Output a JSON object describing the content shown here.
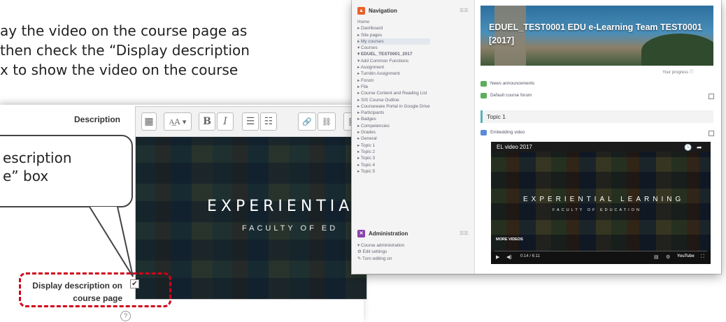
{
  "instructions": {
    "line1": "ay the video on the course page as",
    "line2": "then check the “Display description",
    "line3": "x to show the video on the course"
  },
  "callout": {
    "line1": "escription",
    "line2": "e” box"
  },
  "settings": {
    "description_label": "Description",
    "display_description_line1": "Display description on",
    "display_description_line2": "course page",
    "display_description_checked": true,
    "checkbox_glyph": "✔",
    "help_glyph": "?",
    "editor_text_line1": "EXPERIENTIAL",
    "editor_text_line2": "FACULTY OF ED",
    "toolbar": [
      "▦",
      "A͟A ▾",
      "B",
      "I",
      "☰",
      "☷",
      "🔗",
      "⛓",
      "▣"
    ]
  },
  "moodle": {
    "nav_title": "Navigation",
    "nav_control": "☰☰",
    "nav_items": [
      "Home",
      "▸ Dashboard",
      "▸ Site pages",
      "▸ My courses",
      "▾ Courses",
      "  ▾ EDUEL_TEST0001_2017",
      "    ▾ Add Common Functions",
      "      ▸ Assignment",
      "      ▸ Turnitin Assignment",
      "      ▸ Forum",
      "      ▸ File",
      "  ▸ Course Content and Reading List",
      "  ▸ SIS Course Outline",
      "  ▸ Courseware Portal in Google Drive",
      "  ▸ Participants",
      "  ▸ Badges",
      "  ▸ Competencies",
      "  ▸ Grades",
      "  ▸ General",
      "  ▸ Topic 1",
      "  ▸ Topic 2",
      "  ▸ Topic 3",
      "  ▸ Topic 4",
      "  ▸ Topic 5"
    ],
    "admin_title": "Administration",
    "admin_items": [
      "▾ Course administration",
      "⚙ Edit settings",
      "✎ Turn editing on"
    ],
    "course_title_line1": "EDUEL_TEST0001 EDU e-Learning Team TEST0001",
    "course_title_line2": "[2017]",
    "progress_label": "Your progress ⓘ",
    "activities": [
      "News announcements",
      "Default course forum"
    ],
    "topic_title": "Topic 1",
    "embed_label": "Embedding video",
    "video": {
      "title": "EL video 2017",
      "top_icons": [
        "🕓",
        "➦"
      ],
      "text_line1": "EXPERIENTIAL LEARNING",
      "text_line2": "FACULTY OF EDUCATION",
      "more_label": "MORE VIDEOS",
      "play": "▶",
      "volume": "◀)",
      "time": "0:14 / 6:11",
      "controls": [
        "▤",
        "⚙",
        "YouTube",
        "⛶"
      ]
    }
  }
}
